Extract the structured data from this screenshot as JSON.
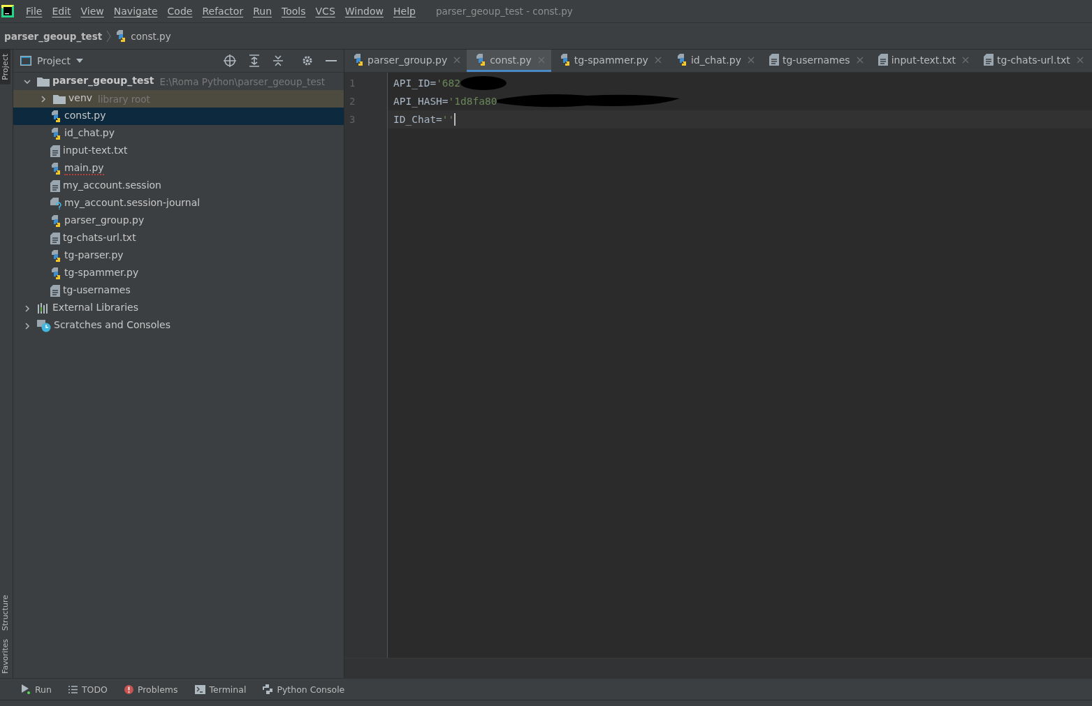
{
  "menu": [
    "File",
    "Edit",
    "View",
    "Navigate",
    "Code",
    "Refactor",
    "Run",
    "Tools",
    "VCS",
    "Window",
    "Help"
  ],
  "window": {
    "title": "parser_geoup_test - const.py"
  },
  "breadcrumb": [
    {
      "label": "parser_geoup_test",
      "kind": "project"
    },
    {
      "label": "const.py",
      "kind": "python"
    }
  ],
  "side_tabs_top": [
    {
      "label": "Project",
      "selected": true
    }
  ],
  "side_tabs_bottom": [
    {
      "label": "Structure",
      "selected": false
    },
    {
      "label": "Favorites",
      "selected": false
    }
  ],
  "project_panel": {
    "title": "Project",
    "tree": [
      {
        "label": "parser_geoup_test",
        "hint": "E:\\Roma Python\\parser_geoup_test",
        "kind": "folder",
        "expanded": true,
        "selected": false,
        "children": [
          {
            "label": "venv",
            "hint": "library root",
            "kind": "folder",
            "expanded": false,
            "selected": false,
            "library": true
          },
          {
            "label": "const.py",
            "kind": "python",
            "selected": true
          },
          {
            "label": "id_chat.py",
            "kind": "python",
            "selected": false
          },
          {
            "label": "input-text.txt",
            "kind": "text",
            "selected": false
          },
          {
            "label": "main.py",
            "kind": "python",
            "selected": false,
            "error": true
          },
          {
            "label": "my_account.session",
            "kind": "text",
            "selected": false
          },
          {
            "label": "my_account.session-journal",
            "kind": "unknown",
            "selected": false
          },
          {
            "label": "parser_group.py",
            "kind": "python",
            "selected": false
          },
          {
            "label": "tg-chats-url.txt",
            "kind": "text",
            "selected": false
          },
          {
            "label": "tg-parser.py",
            "kind": "python",
            "selected": false
          },
          {
            "label": "tg-spammer.py",
            "kind": "python",
            "selected": false
          },
          {
            "label": "tg-usernames",
            "kind": "text",
            "selected": false
          }
        ]
      },
      {
        "label": "External Libraries",
        "kind": "libraries",
        "expanded": false,
        "selected": false
      },
      {
        "label": "Scratches and Consoles",
        "kind": "scratches",
        "expanded": false,
        "selected": false
      }
    ]
  },
  "tabs": [
    {
      "label": "parser_group.py",
      "kind": "python",
      "selected": false
    },
    {
      "label": "const.py",
      "kind": "python",
      "selected": true
    },
    {
      "label": "tg-spammer.py",
      "kind": "python",
      "selected": false
    },
    {
      "label": "id_chat.py",
      "kind": "python",
      "selected": false
    },
    {
      "label": "tg-usernames",
      "kind": "text",
      "selected": false
    },
    {
      "label": "input-text.txt",
      "kind": "text",
      "selected": false
    },
    {
      "label": "tg-chats-url.txt",
      "kind": "text",
      "selected": false
    }
  ],
  "code": [
    {
      "number": "1",
      "name": "API_ID",
      "op": "=",
      "value": "'682",
      "redacted": true,
      "current": false
    },
    {
      "number": "2",
      "name": "API_HASH",
      "op": "=",
      "value": "'1d8fa80",
      "redacted": true,
      "current": false
    },
    {
      "number": "3",
      "name": "ID_Chat",
      "op": "=",
      "value": "''",
      "redacted": false,
      "current": true
    }
  ],
  "tool_windows": [
    {
      "label": "Run",
      "kind": "run"
    },
    {
      "label": "TODO",
      "kind": "todo"
    },
    {
      "label": "Problems",
      "kind": "problems"
    },
    {
      "label": "Terminal",
      "kind": "terminal"
    },
    {
      "label": "Python Console",
      "kind": "python"
    }
  ]
}
